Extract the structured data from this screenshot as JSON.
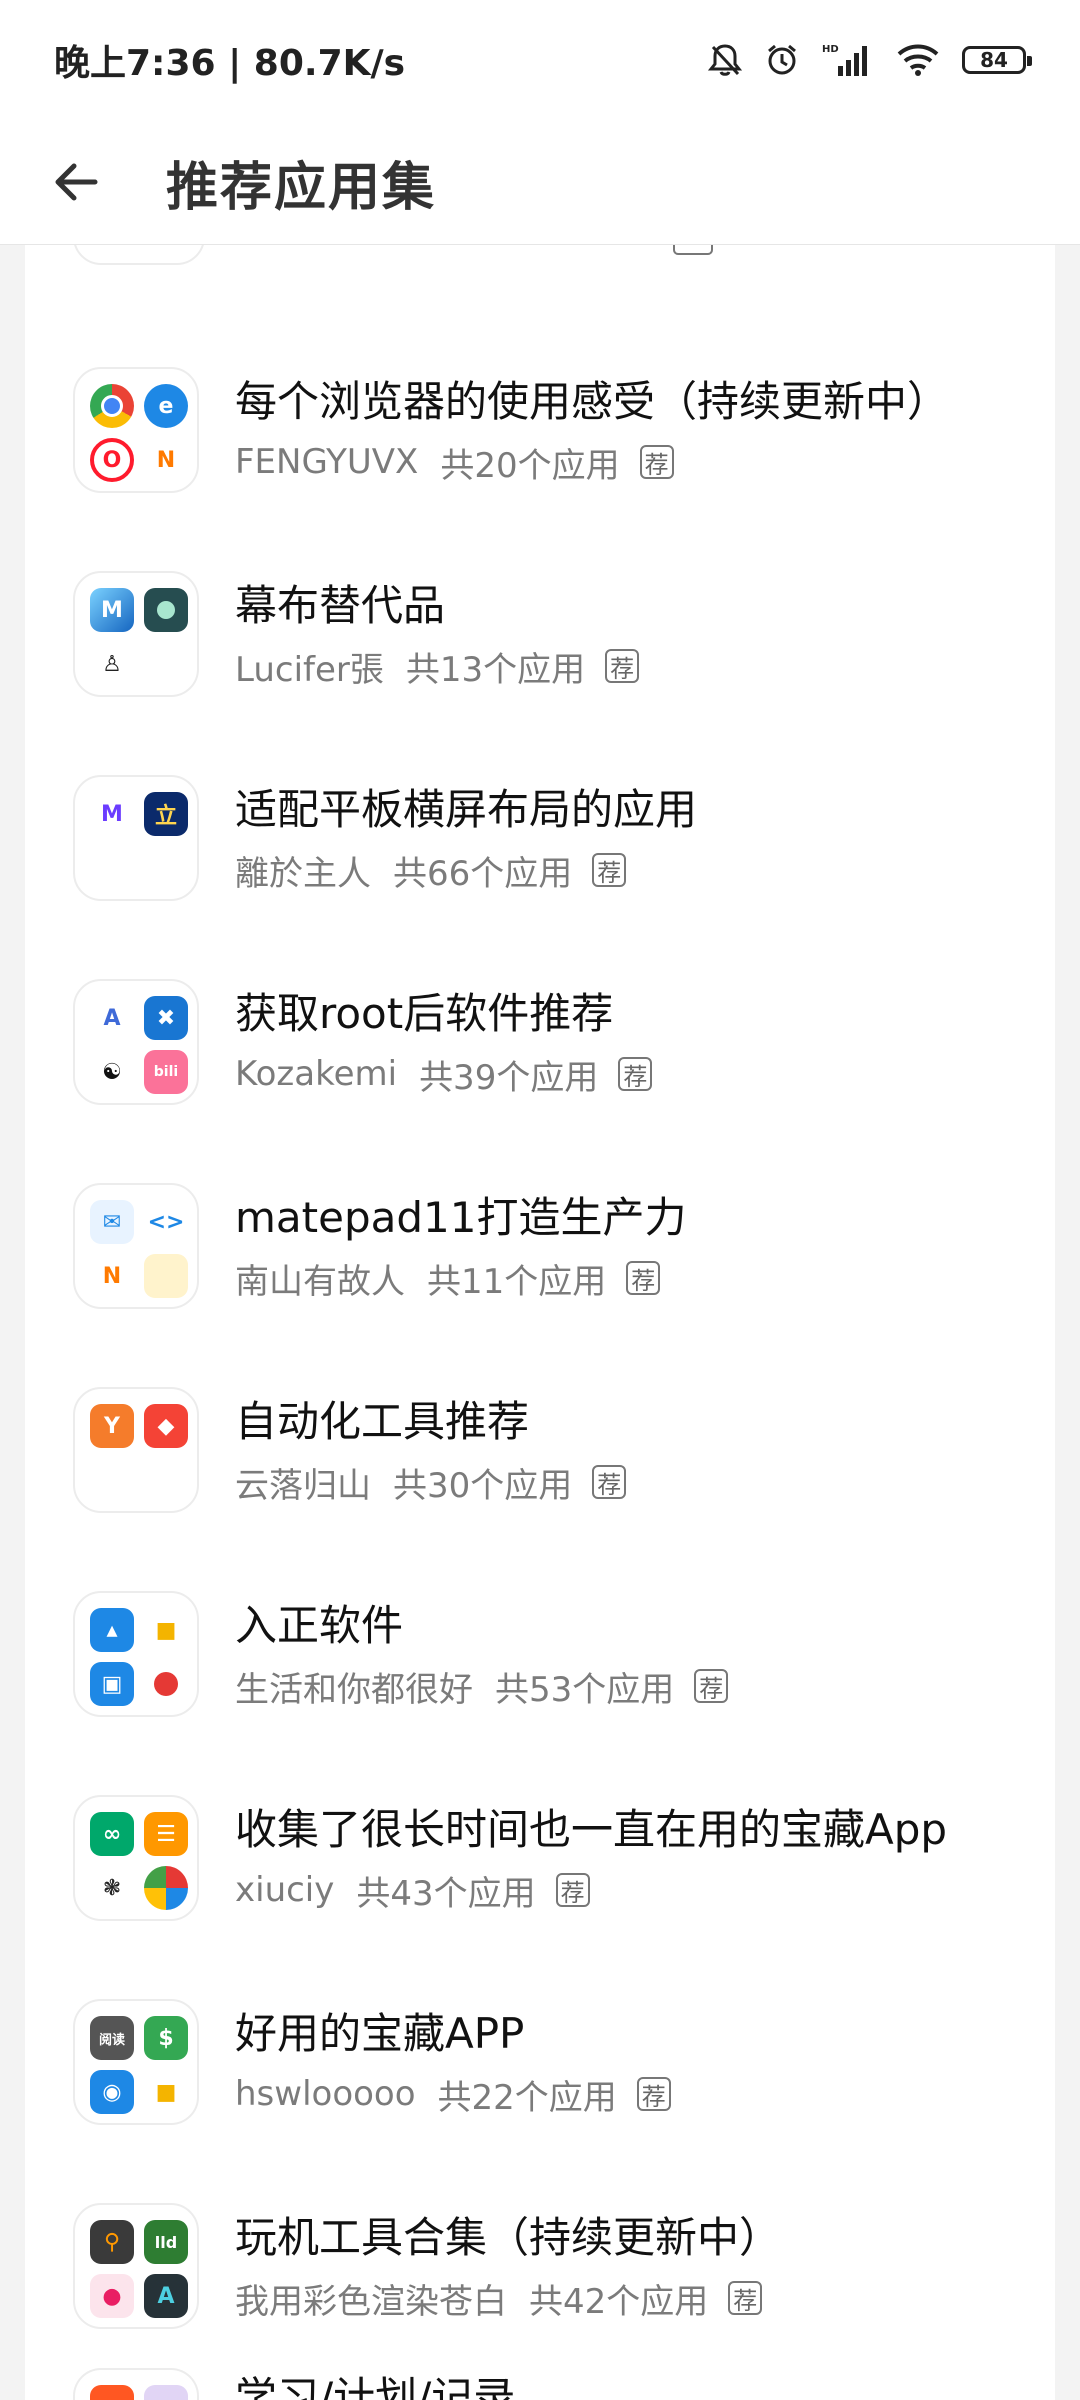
{
  "status_bar": {
    "time": "晚上7:36",
    "separator": "|",
    "speed": "80.7K/s",
    "battery": "84",
    "icons": [
      "bell-muted-icon",
      "alarm-icon",
      "hd-signal-icon",
      "wifi-icon",
      "battery-icon"
    ]
  },
  "header": {
    "back_icon": "arrow-left-icon",
    "title": "推荐应用集"
  },
  "tag_label": "荐",
  "collections": [
    {
      "title": "每个浏览器的使用感受（持续更新中）",
      "author": "FENGYUVX",
      "count": "共20个应用"
    },
    {
      "title": "幕布替代品",
      "author": "Lucifer張",
      "count": "共13个应用"
    },
    {
      "title": "适配平板横屏布局的应用",
      "author": "離於主人",
      "count": "共66个应用"
    },
    {
      "title": "获取root后软件推荐",
      "author": "Kozakemi",
      "count": "共39个应用"
    },
    {
      "title": "matepad11打造生产力",
      "author": "南山有故人",
      "count": "共11个应用"
    },
    {
      "title": "自动化工具推荐",
      "author": "云落归山",
      "count": "共30个应用"
    },
    {
      "title": "入正软件",
      "author": "生活和你都很好",
      "count": "共53个应用"
    },
    {
      "title": "收集了很长时间也一直在用的宝藏App",
      "author": "xiuciy",
      "count": "共43个应用"
    },
    {
      "title": "好用的宝藏APP",
      "author": "hswlooooo",
      "count": "共22个应用"
    },
    {
      "title": "玩机工具合集（持续更新中）",
      "author": "我用彩色渲染苍白",
      "count": "共42个应用"
    }
  ],
  "partial_next_title": "学习/计划/记录",
  "icon_glyphs": {
    "edge": "e",
    "opera": "O",
    "notion_like": "N",
    "mubu": "M",
    "li": "立",
    "fdroid": "A",
    "bilibili": "bili",
    "vscode": "<>",
    "ybox": "Y",
    "ai": "A",
    "lld": "lld",
    "yuedu": "阅读"
  },
  "colors": {
    "header_bg": "#ffffff",
    "page_bg": "#f3f3f3",
    "title_text": "#111111",
    "meta_text": "#7b7b7b",
    "tag_border": "#777777"
  }
}
